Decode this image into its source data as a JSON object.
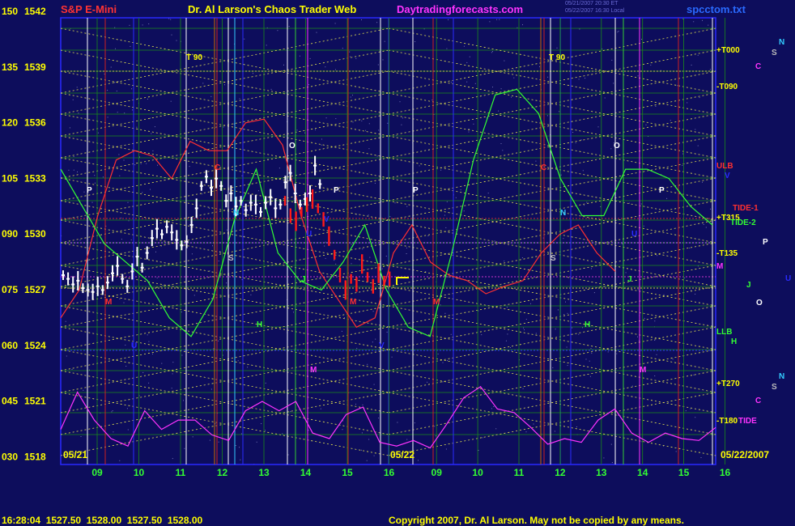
{
  "header": {
    "symbol": "S&P E-Mini",
    "title": "Dr. Al Larson's Chaos Trader Web",
    "site": "Daytradingforecasts.com",
    "file": "spcctom.txt",
    "stamp1": "05/21/2007 20:30 ET",
    "stamp2": "05/22/2007 16:30 Local"
  },
  "footer": {
    "quote": "16:28:04  1527.50  1528.00  1527.50  1528.00",
    "copyright": "Copyright 2007, Dr. Al Larson. May not be copied by any means."
  },
  "colors": {
    "background": "#0d0d5c",
    "price_bars": "#ffffff",
    "today_bars": "#ff1a1a",
    "frame": "#2a2aff",
    "tide": "#ff33ff",
    "grid_green": "#1a8a1a",
    "dotted_yellow": "#e6e650"
  },
  "chart_data": {
    "type": "bar",
    "instrument": "S&P E-Mini",
    "y_left_labels": [
      {
        "osc": "150",
        "price": "1542"
      },
      {
        "osc": "135",
        "price": "1539"
      },
      {
        "osc": "120",
        "price": "1536"
      },
      {
        "osc": "105",
        "price": "1533"
      },
      {
        "osc": "090",
        "price": "1530"
      },
      {
        "osc": "075",
        "price": "1527"
      },
      {
        "osc": "060",
        "price": "1524"
      },
      {
        "osc": "045",
        "price": "1521"
      },
      {
        "osc": "030",
        "price": "1518"
      }
    ],
    "ylim": [
      1518,
      1542
    ],
    "x_hours": [
      "09",
      "10",
      "11",
      "12",
      "13",
      "14",
      "15",
      "16",
      "09",
      "10",
      "11",
      "12",
      "13",
      "14",
      "15",
      "16"
    ],
    "dates": [
      "05/21",
      "05/22",
      "05/22/2007"
    ],
    "right_labels": [
      {
        "text": "+T000",
        "color": "#ffff00"
      },
      {
        "text": "-T090",
        "color": "#ffff00"
      },
      {
        "text": "ULB",
        "color": "#ff3030"
      },
      {
        "text": "V",
        "color": "#2a2aff"
      },
      {
        "text": "TIDE-1",
        "color": "#ff3030"
      },
      {
        "text": "+T315",
        "color": "#ffff00"
      },
      {
        "text": "TIDE-2",
        "color": "#33ff33"
      },
      {
        "text": "-T135",
        "color": "#ffff00"
      },
      {
        "text": "M",
        "color": "#ff33ff"
      },
      {
        "text": "LLB",
        "color": "#33ff33"
      },
      {
        "text": "H",
        "color": "#33ff33"
      },
      {
        "text": "+T270",
        "color": "#ffff00"
      },
      {
        "text": "-T180",
        "color": "#ffff00"
      },
      {
        "text": "TIDE",
        "color": "#ff33ff"
      }
    ],
    "planet_glyphs": [
      {
        "text": "N",
        "color": "#33ccff"
      },
      {
        "text": "S",
        "color": "#bbbbbb"
      },
      {
        "text": "C",
        "color": "#ff33ff"
      },
      {
        "text": "P",
        "color": "#ffffff"
      },
      {
        "text": "J",
        "color": "#33ff33"
      },
      {
        "text": "U",
        "color": "#2a2aff"
      },
      {
        "text": "O",
        "color": "#ffffff"
      },
      {
        "text": "N",
        "color": "#33ccff"
      },
      {
        "text": "S",
        "color": "#bbbbbb"
      },
      {
        "text": "C",
        "color": "#ff33ff"
      }
    ],
    "chart_letters": [
      {
        "text": "T 90",
        "color": "#ffff00"
      },
      {
        "text": "T 90",
        "color": "#ffff00"
      },
      {
        "text": "O",
        "color": "#ffffff"
      },
      {
        "text": "O",
        "color": "#ffffff"
      },
      {
        "text": "P",
        "color": "#ffffff"
      },
      {
        "text": "P",
        "color": "#ffffff"
      },
      {
        "text": "P",
        "color": "#ffffff"
      },
      {
        "text": "P",
        "color": "#ffffff"
      },
      {
        "text": "N",
        "color": "#33ccff"
      },
      {
        "text": "N",
        "color": "#33ccff"
      },
      {
        "text": "S",
        "color": "#bbbbbb"
      },
      {
        "text": "S",
        "color": "#bbbbbb"
      },
      {
        "text": "H",
        "color": "#33ff33"
      },
      {
        "text": "H",
        "color": "#33ff33"
      },
      {
        "text": "M",
        "color": "#ff33ff"
      },
      {
        "text": "M",
        "color": "#ff33ff"
      },
      {
        "text": "C",
        "color": "#ff3030"
      },
      {
        "text": "C",
        "color": "#ff3030"
      },
      {
        "text": "U",
        "color": "#2a2aff"
      },
      {
        "text": "U",
        "color": "#2a2aff"
      },
      {
        "text": "U",
        "color": "#2a2aff"
      },
      {
        "text": "M",
        "color": "#ff3030"
      },
      {
        "text": "M",
        "color": "#ff3030"
      },
      {
        "text": "M",
        "color": "#ff3030"
      },
      {
        "text": "J",
        "color": "#33ff33"
      },
      {
        "text": "J",
        "color": "#33ff33"
      },
      {
        "text": "V",
        "color": "#2a2aff"
      },
      {
        "text": "V",
        "color": "#2a2aff"
      }
    ],
    "series": [
      {
        "name": "bars",
        "color": "#ffffff",
        "values": [
          1527.8,
          1527.6,
          1527.3,
          1527.5,
          1527.1,
          1527.0,
          1526.9,
          1527.2,
          1527.0,
          1527.4,
          1527.9,
          1528.3,
          1527.6,
          1527.2,
          1528.0,
          1528.8,
          1528.2,
          1529.0,
          1529.8,
          1530.3,
          1530.0,
          1530.4,
          1530.1,
          1529.7,
          1529.4,
          1529.6,
          1530.5,
          1531.4,
          1532.6,
          1533.1,
          1532.5,
          1533.0,
          1532.6,
          1531.8,
          1532.2,
          1531.5,
          1531.8,
          1531.3,
          1531.7,
          1531.6,
          1531.2,
          1531.7,
          1532.0,
          1531.4,
          1531.6,
          1532.8,
          1533.3,
          1532.2,
          1531.6,
          1531.9,
          1532.2,
          1533.7,
          1532.7
        ]
      },
      {
        "name": "today",
        "color": "#ff1a1a",
        "values": [
          1531.8,
          1531.0,
          1530.7,
          1531.2,
          1531.6,
          1531.9,
          1531.4,
          1530.8,
          1529.9,
          1528.9,
          1527.8,
          1527.0,
          1527.6,
          1527.3,
          1528.4,
          1527.7,
          1527.2,
          1527.9,
          1527.5,
          1527.6
        ]
      },
      {
        "name": "ULB",
        "color": "#ff3030",
        "values": [
          1525.5,
          1527.0,
          1531.0,
          1534.0,
          1534.5,
          1534.2,
          1533.0,
          1535.0,
          1534.5,
          1534.5,
          1536.0,
          1536.2,
          1534.8,
          1531.0,
          1528.0,
          1526.5,
          1525.0,
          1525.5,
          1529.0,
          1530.5,
          1528.5,
          1527.8,
          1527.5,
          1526.8,
          1527.2,
          1527.5,
          1529.0,
          1530.0,
          1530.5,
          1529.0,
          1528.0
        ]
      },
      {
        "name": "LLB",
        "color": "#33ff33",
        "values": [
          1533.5,
          1531.5,
          1529.5,
          1528.5,
          1527.5,
          1525.5,
          1524.5,
          1526.5,
          1530.8,
          1533.5,
          1529.0,
          1527.5,
          1527.0,
          1528.5,
          1530.5,
          1527.0,
          1525.0,
          1524.5,
          1529.0,
          1534.0,
          1537.5,
          1537.8,
          1536.5,
          1533.0,
          1531.0,
          1531.0,
          1533.5,
          1533.5,
          1533.0,
          1531.5,
          1530.5
        ]
      },
      {
        "name": "TIDE",
        "color": "#ff33ff",
        "values": [
          1519.5,
          1521.5,
          1520.0,
          1519.0,
          1518.6,
          1520.5,
          1519.5,
          1520.0,
          1520.0,
          1519.2,
          1518.9,
          1520.5,
          1521.0,
          1520.5,
          1521.0,
          1519.3,
          1519.0,
          1520.3,
          1520.7,
          1518.8,
          1518.6,
          1518.9,
          1518.5,
          1519.8,
          1521.2,
          1521.8,
          1520.6,
          1520.4,
          1519.6,
          1518.7,
          1519.0,
          1518.8,
          1520.0,
          1520.6,
          1519.3,
          1518.8,
          1519.3,
          1519.0,
          1518.9,
          1519.6
        ]
      }
    ]
  }
}
